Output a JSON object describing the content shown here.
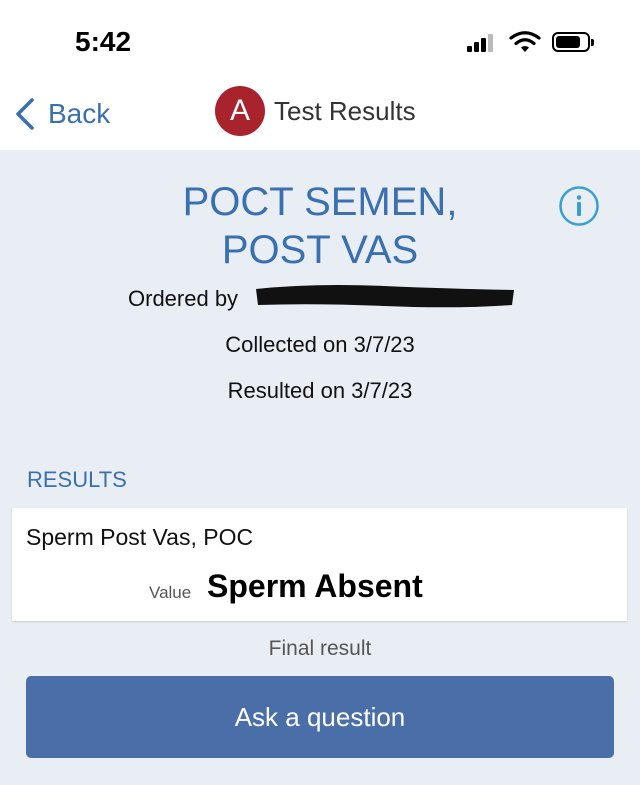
{
  "status_bar": {
    "time": "5:42"
  },
  "nav": {
    "back_label": "Back",
    "avatar_letter": "A",
    "title": "Test Results"
  },
  "test": {
    "title_line1": "POCT SEMEN,",
    "title_line2": "POST VAS",
    "ordered_by_label": "Ordered by",
    "collected": "Collected on 3/7/23",
    "resulted": "Resulted on 3/7/23"
  },
  "results": {
    "section_label": "RESULTS",
    "items": [
      {
        "component": "Sperm Post Vas, POC",
        "value_label": "Value",
        "value": "Sperm Absent"
      }
    ],
    "status": "Final result"
  },
  "actions": {
    "ask_label": "Ask a question"
  },
  "colors": {
    "accent": "#3a6fb0",
    "avatar": "#a8232c",
    "button": "#4a6fa8",
    "background": "#e9eef5"
  },
  "icons": [
    "chevron-left-icon",
    "info-icon",
    "signal-icon",
    "wifi-icon",
    "battery-icon"
  ]
}
